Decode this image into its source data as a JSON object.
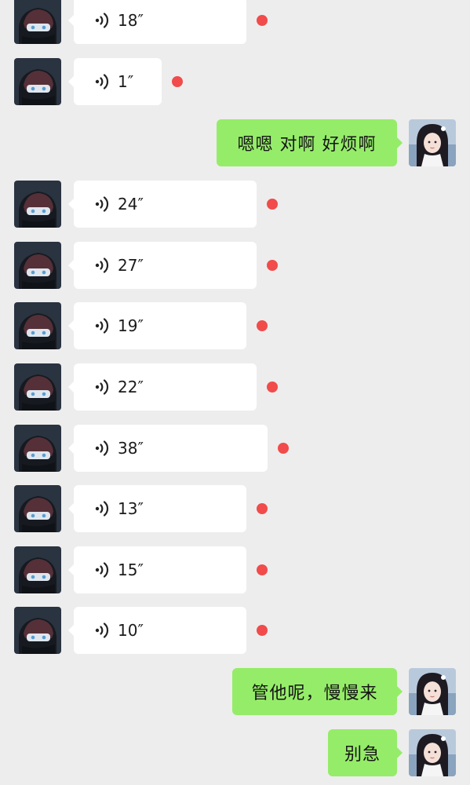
{
  "messages": [
    {
      "side": "left",
      "type": "voice",
      "duration": "18″",
      "unread": true
    },
    {
      "side": "left",
      "type": "voice",
      "duration": "1″",
      "unread": true
    },
    {
      "side": "right",
      "type": "text",
      "text": "嗯嗯 对啊 好烦啊"
    },
    {
      "side": "left",
      "type": "voice",
      "duration": "24″",
      "unread": true
    },
    {
      "side": "left",
      "type": "voice",
      "duration": "27″",
      "unread": true
    },
    {
      "side": "left",
      "type": "voice",
      "duration": "19″",
      "unread": true
    },
    {
      "side": "left",
      "type": "voice",
      "duration": "22″",
      "unread": true
    },
    {
      "side": "left",
      "type": "voice",
      "duration": "38″",
      "unread": true
    },
    {
      "side": "left",
      "type": "voice",
      "duration": "13″",
      "unread": true
    },
    {
      "side": "left",
      "type": "voice",
      "duration": "15″",
      "unread": true
    },
    {
      "side": "left",
      "type": "voice",
      "duration": "10″",
      "unread": true
    },
    {
      "side": "right",
      "type": "text",
      "text": "管他呢，慢慢来"
    },
    {
      "side": "right",
      "type": "text",
      "text": "别急"
    }
  ],
  "icons": {
    "voice": "voice-wave-icon",
    "left_avatar": "masked-character-avatar",
    "right_avatar": "anime-girl-avatar"
  },
  "colors": {
    "background": "#ededed",
    "incoming_bubble": "#ffffff",
    "outgoing_bubble": "#95ec69",
    "unread_dot": "#f14b4b"
  }
}
